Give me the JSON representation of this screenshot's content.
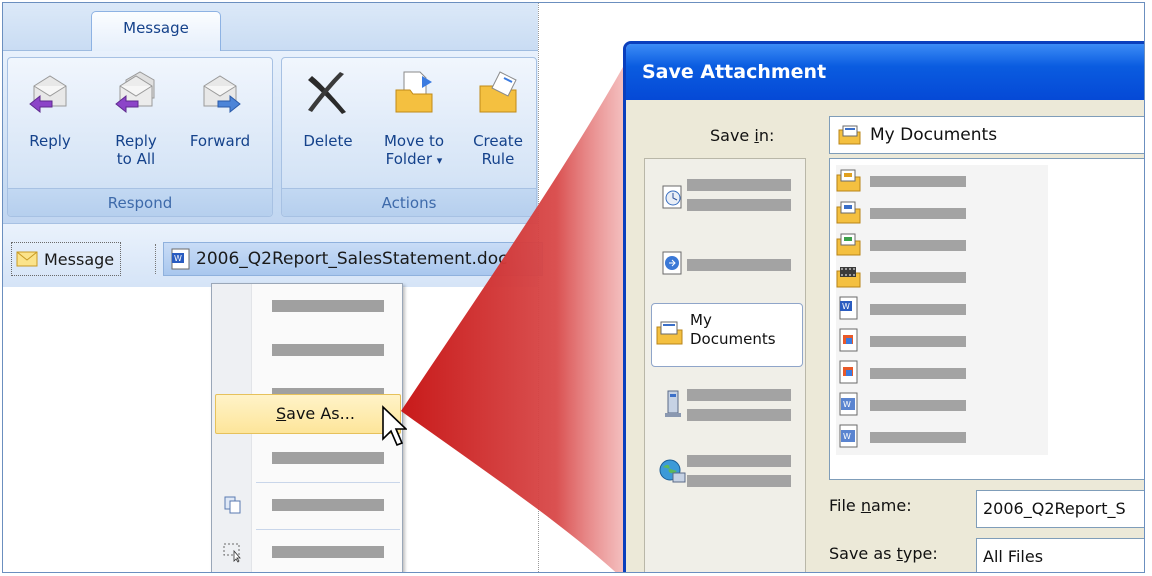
{
  "ribbon": {
    "tab_label": "Message",
    "groups": {
      "respond": {
        "label": "Respond",
        "reply": "Reply",
        "reply_all_line1": "Reply",
        "reply_all_line2": "to All",
        "forward": "Forward"
      },
      "actions": {
        "label": "Actions",
        "delete": "Delete",
        "move_line1": "Move to",
        "move_line2": "Folder",
        "move_dropdown": "▾",
        "create_line1": "Create",
        "create_line2": "Rule"
      }
    }
  },
  "message_strip": {
    "message_tab": "Message",
    "attachment_name": "2006_Q2Report_SalesStatement.doc"
  },
  "context_menu": {
    "save_as_prefix": "",
    "save_as_underlined": "S",
    "save_as_rest": "ave As..."
  },
  "dialog": {
    "title": "Save Attachment",
    "save_in_label_a": "Save ",
    "save_in_label_u": "i",
    "save_in_label_b": "n:",
    "save_in_value": "My Documents",
    "places_my_documents_line1": "My",
    "places_my_documents_line2": "Documents",
    "file_name_label_a": "File ",
    "file_name_label_u": "n",
    "file_name_label_b": "ame:",
    "file_name_value": "2006_Q2Report_S",
    "save_type_label_a": "Save as ",
    "save_type_label_u": "t",
    "save_type_label_b": "ype:",
    "save_type_value": "All Files"
  },
  "colors": {
    "ribbon_text": "#15428b",
    "dialog_title_bar": "#0549d6",
    "highlight": "#fde59a",
    "zoom_red": "#cc2020"
  }
}
